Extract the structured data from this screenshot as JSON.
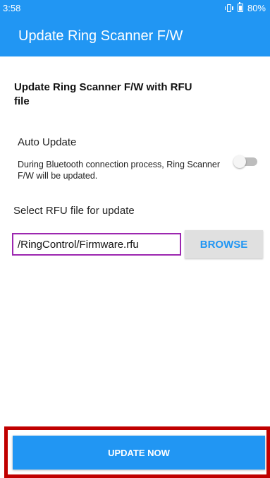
{
  "status_bar": {
    "time": "3:58",
    "battery": "80%"
  },
  "app_bar": {
    "title": "Update Ring Scanner F/W"
  },
  "content": {
    "section_title": "Update Ring Scanner F/W with RFU file",
    "auto_update": {
      "label": "Auto Update",
      "description": "During Bluetooth connection process, Ring Scanner F/W will be updated.",
      "enabled": false
    },
    "select_label": "Select RFU file for update",
    "file_path": "/RingControl/Firmware.rfu",
    "browse_label": "BROWSE"
  },
  "footer": {
    "update_label": "UPDATE NOW"
  },
  "colors": {
    "primary": "#2196F3",
    "focus": "#9C27B0",
    "highlight_frame": "#C00000"
  },
  "icons": [
    "vibrate-icon",
    "battery-icon"
  ]
}
